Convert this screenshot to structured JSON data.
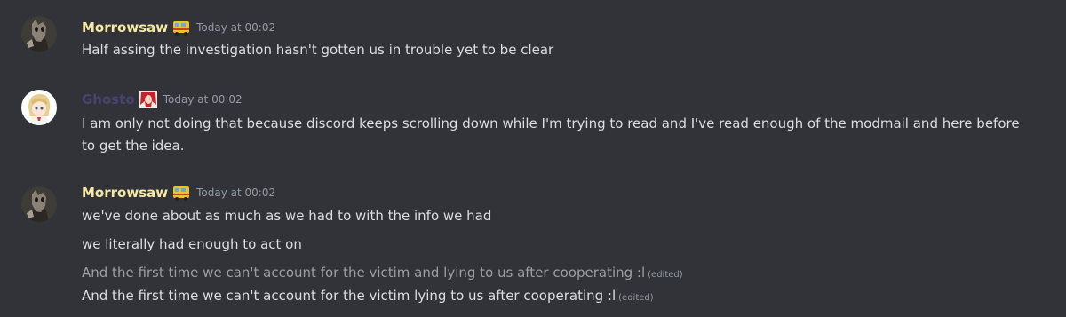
{
  "colors": {
    "background": "#313338",
    "text": "#dbdee1",
    "muted": "#949ba4",
    "morrowsaw_name": "#f7e8a2",
    "ghosto_name": "#4a4270"
  },
  "messages": [
    {
      "author": "Morrowsaw",
      "avatar_icon": "masked-figure-avatar",
      "role_icon": "yellow-bus-icon",
      "timestamp": "Today at 00:02",
      "lines": [
        {
          "text": "Half assing the investigation hasn't gotten us in trouble yet to be clear"
        }
      ]
    },
    {
      "author": "Ghosto",
      "avatar_icon": "anime-girl-avatar",
      "role_icon": "red-hair-character-icon",
      "timestamp": "Today at 00:02",
      "lines": [
        {
          "text": "I am only not doing that because discord keeps scrolling down while I'm trying to read and I've read enough of the modmail and here before to get the idea."
        }
      ]
    },
    {
      "author": "Morrowsaw",
      "avatar_icon": "masked-figure-avatar",
      "role_icon": "yellow-bus-icon",
      "timestamp": "Today at 00:02",
      "lines": [
        {
          "text": "we've done about as much as we had to with the info we had"
        },
        {
          "text": "we literally had enough to act on"
        },
        {
          "text": "And the first time we can't account for the victim and lying to us after cooperating :l",
          "edited": "(edited)"
        },
        {
          "text": "And the first time we can't account for the victim lying to us after cooperating :l",
          "edited": "(edited)"
        }
      ]
    }
  ]
}
